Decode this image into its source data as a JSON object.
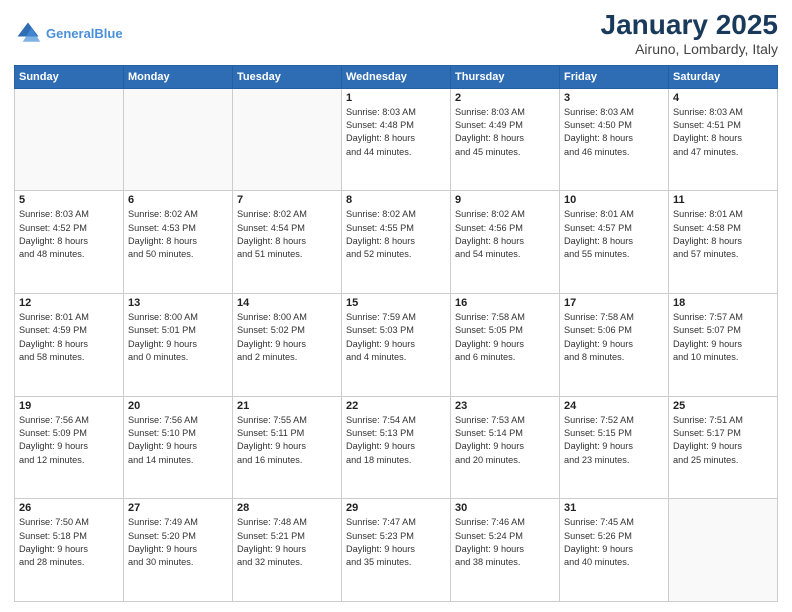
{
  "header": {
    "logo_line1": "General",
    "logo_line2": "Blue",
    "month": "January 2025",
    "location": "Airuno, Lombardy, Italy"
  },
  "weekdays": [
    "Sunday",
    "Monday",
    "Tuesday",
    "Wednesday",
    "Thursday",
    "Friday",
    "Saturday"
  ],
  "weeks": [
    [
      {
        "day": "",
        "info": ""
      },
      {
        "day": "",
        "info": ""
      },
      {
        "day": "",
        "info": ""
      },
      {
        "day": "1",
        "info": "Sunrise: 8:03 AM\nSunset: 4:48 PM\nDaylight: 8 hours\nand 44 minutes."
      },
      {
        "day": "2",
        "info": "Sunrise: 8:03 AM\nSunset: 4:49 PM\nDaylight: 8 hours\nand 45 minutes."
      },
      {
        "day": "3",
        "info": "Sunrise: 8:03 AM\nSunset: 4:50 PM\nDaylight: 8 hours\nand 46 minutes."
      },
      {
        "day": "4",
        "info": "Sunrise: 8:03 AM\nSunset: 4:51 PM\nDaylight: 8 hours\nand 47 minutes."
      }
    ],
    [
      {
        "day": "5",
        "info": "Sunrise: 8:03 AM\nSunset: 4:52 PM\nDaylight: 8 hours\nand 48 minutes."
      },
      {
        "day": "6",
        "info": "Sunrise: 8:02 AM\nSunset: 4:53 PM\nDaylight: 8 hours\nand 50 minutes."
      },
      {
        "day": "7",
        "info": "Sunrise: 8:02 AM\nSunset: 4:54 PM\nDaylight: 8 hours\nand 51 minutes."
      },
      {
        "day": "8",
        "info": "Sunrise: 8:02 AM\nSunset: 4:55 PM\nDaylight: 8 hours\nand 52 minutes."
      },
      {
        "day": "9",
        "info": "Sunrise: 8:02 AM\nSunset: 4:56 PM\nDaylight: 8 hours\nand 54 minutes."
      },
      {
        "day": "10",
        "info": "Sunrise: 8:01 AM\nSunset: 4:57 PM\nDaylight: 8 hours\nand 55 minutes."
      },
      {
        "day": "11",
        "info": "Sunrise: 8:01 AM\nSunset: 4:58 PM\nDaylight: 8 hours\nand 57 minutes."
      }
    ],
    [
      {
        "day": "12",
        "info": "Sunrise: 8:01 AM\nSunset: 4:59 PM\nDaylight: 8 hours\nand 58 minutes."
      },
      {
        "day": "13",
        "info": "Sunrise: 8:00 AM\nSunset: 5:01 PM\nDaylight: 9 hours\nand 0 minutes."
      },
      {
        "day": "14",
        "info": "Sunrise: 8:00 AM\nSunset: 5:02 PM\nDaylight: 9 hours\nand 2 minutes."
      },
      {
        "day": "15",
        "info": "Sunrise: 7:59 AM\nSunset: 5:03 PM\nDaylight: 9 hours\nand 4 minutes."
      },
      {
        "day": "16",
        "info": "Sunrise: 7:58 AM\nSunset: 5:05 PM\nDaylight: 9 hours\nand 6 minutes."
      },
      {
        "day": "17",
        "info": "Sunrise: 7:58 AM\nSunset: 5:06 PM\nDaylight: 9 hours\nand 8 minutes."
      },
      {
        "day": "18",
        "info": "Sunrise: 7:57 AM\nSunset: 5:07 PM\nDaylight: 9 hours\nand 10 minutes."
      }
    ],
    [
      {
        "day": "19",
        "info": "Sunrise: 7:56 AM\nSunset: 5:09 PM\nDaylight: 9 hours\nand 12 minutes."
      },
      {
        "day": "20",
        "info": "Sunrise: 7:56 AM\nSunset: 5:10 PM\nDaylight: 9 hours\nand 14 minutes."
      },
      {
        "day": "21",
        "info": "Sunrise: 7:55 AM\nSunset: 5:11 PM\nDaylight: 9 hours\nand 16 minutes."
      },
      {
        "day": "22",
        "info": "Sunrise: 7:54 AM\nSunset: 5:13 PM\nDaylight: 9 hours\nand 18 minutes."
      },
      {
        "day": "23",
        "info": "Sunrise: 7:53 AM\nSunset: 5:14 PM\nDaylight: 9 hours\nand 20 minutes."
      },
      {
        "day": "24",
        "info": "Sunrise: 7:52 AM\nSunset: 5:15 PM\nDaylight: 9 hours\nand 23 minutes."
      },
      {
        "day": "25",
        "info": "Sunrise: 7:51 AM\nSunset: 5:17 PM\nDaylight: 9 hours\nand 25 minutes."
      }
    ],
    [
      {
        "day": "26",
        "info": "Sunrise: 7:50 AM\nSunset: 5:18 PM\nDaylight: 9 hours\nand 28 minutes."
      },
      {
        "day": "27",
        "info": "Sunrise: 7:49 AM\nSunset: 5:20 PM\nDaylight: 9 hours\nand 30 minutes."
      },
      {
        "day": "28",
        "info": "Sunrise: 7:48 AM\nSunset: 5:21 PM\nDaylight: 9 hours\nand 32 minutes."
      },
      {
        "day": "29",
        "info": "Sunrise: 7:47 AM\nSunset: 5:23 PM\nDaylight: 9 hours\nand 35 minutes."
      },
      {
        "day": "30",
        "info": "Sunrise: 7:46 AM\nSunset: 5:24 PM\nDaylight: 9 hours\nand 38 minutes."
      },
      {
        "day": "31",
        "info": "Sunrise: 7:45 AM\nSunset: 5:26 PM\nDaylight: 9 hours\nand 40 minutes."
      },
      {
        "day": "",
        "info": ""
      }
    ]
  ]
}
